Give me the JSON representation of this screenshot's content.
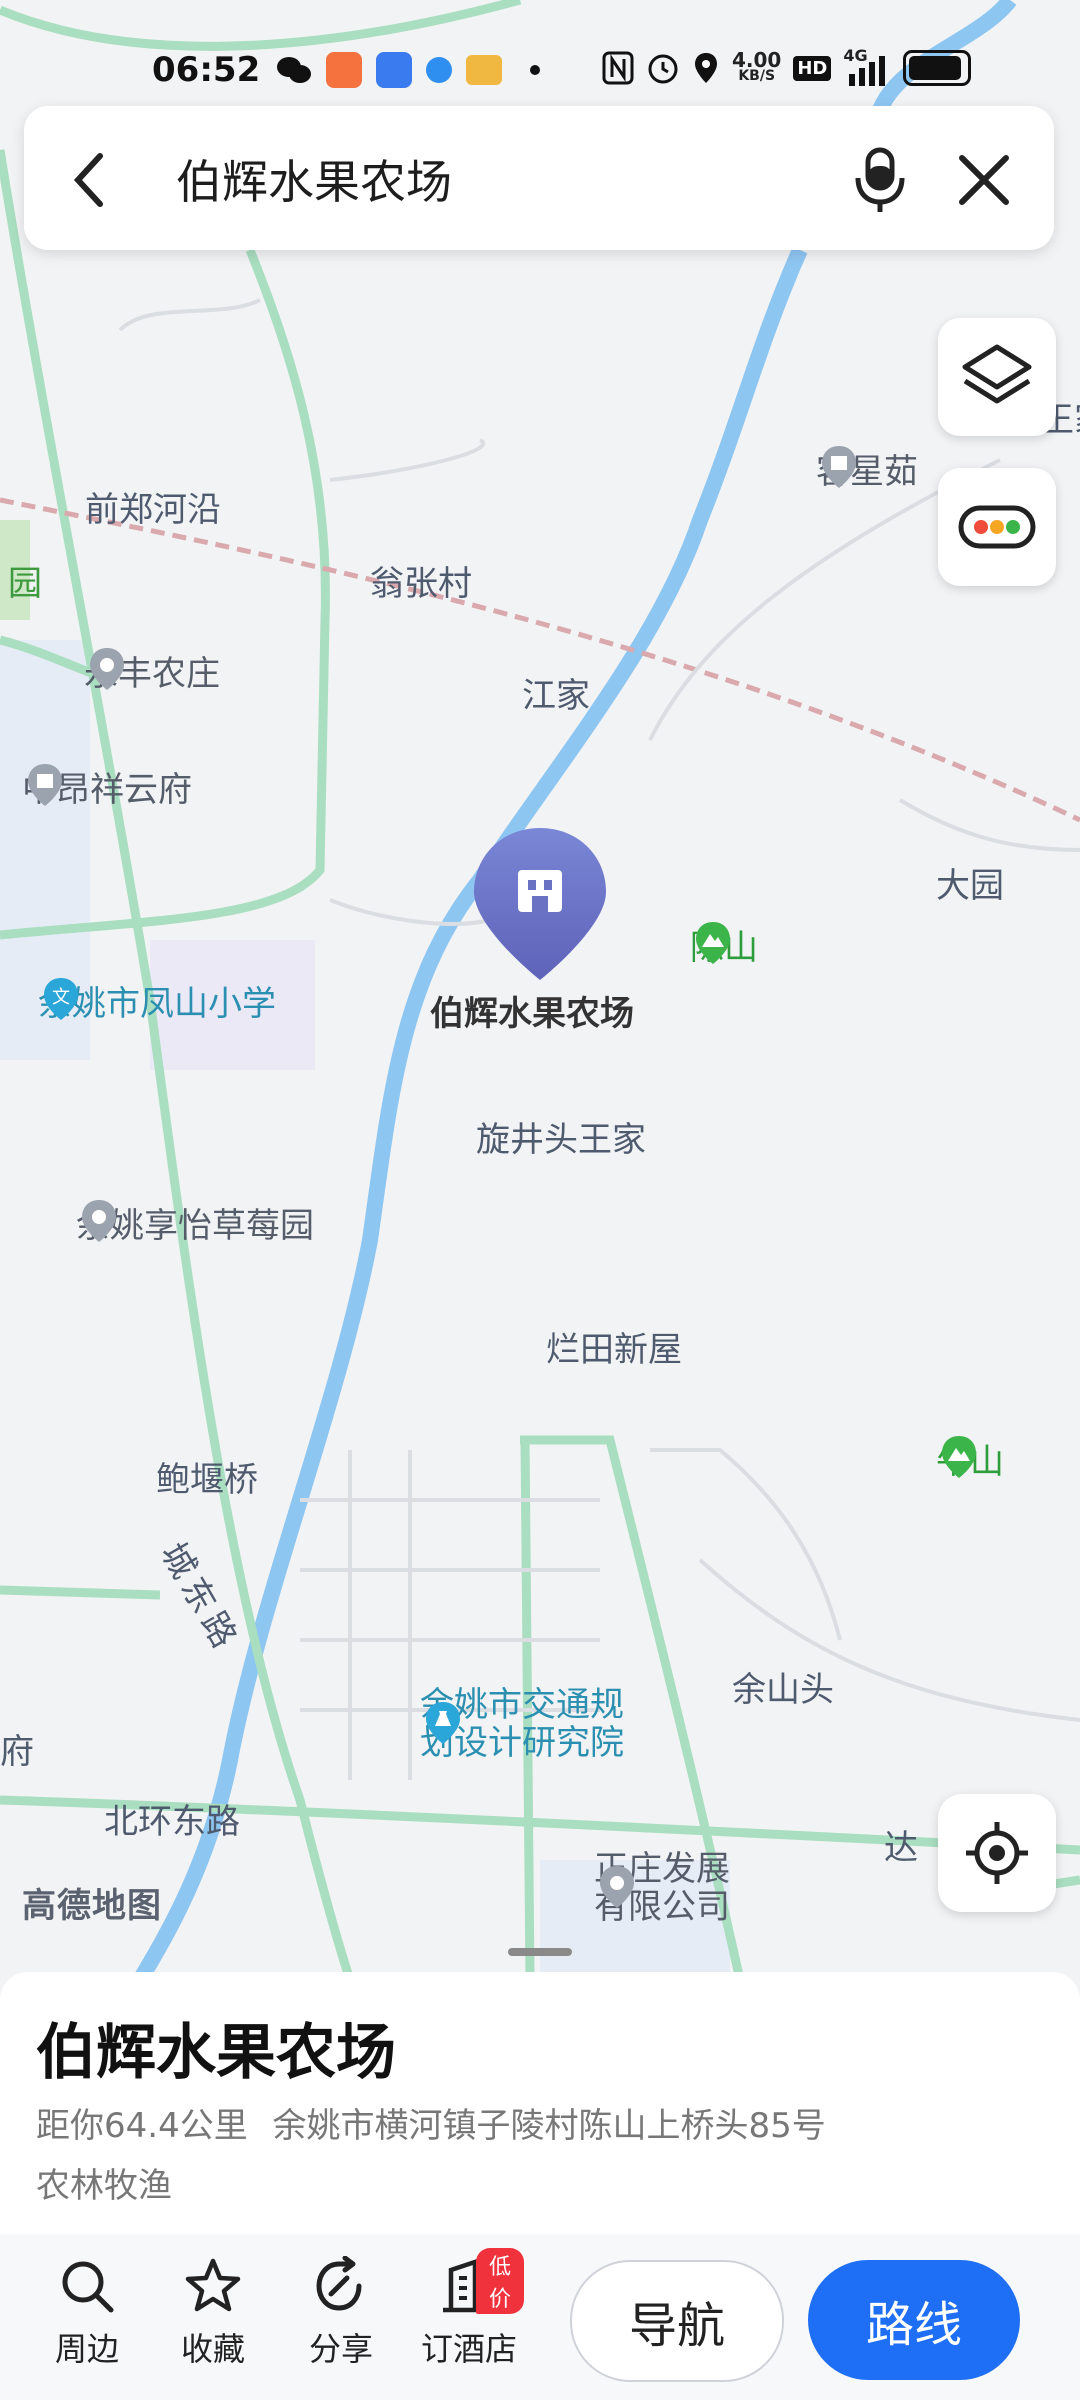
{
  "status_bar": {
    "time": "06:52",
    "net_speed_value": "4.00",
    "net_speed_unit": "KB/S",
    "hd": "HD",
    "signal": "4G"
  },
  "search": {
    "query": "伯辉水果农场"
  },
  "map": {
    "selected_marker_label": "伯辉水果农场",
    "logo_text": "高德地图",
    "place_labels": {
      "qianzheng": "前郑河沿",
      "wengzhang": "翁张村",
      "jiangjia": "江家",
      "dayuan": "大园",
      "xuanjing": "旋井头王家",
      "lantian": "烂田新屋",
      "baoyanqiao": "鲍堰桥",
      "chengdonglu": "城东路",
      "yushantou": "余山头",
      "beihuan": "北环东路",
      "da": "达",
      "yuan_left": "园",
      "fu_left": "府",
      "jia_right": "王家"
    },
    "pois": {
      "yongfeng": "永丰农庄",
      "zhongang": "中昂祥云府",
      "fengshan_school": "余姚市凤山小学",
      "caomei": "余姚享怡草莓园",
      "chenshan": "陈山",
      "niushan": "牛山",
      "kexing": "客星茹",
      "jiaotong_line1": "余姚市交通规",
      "jiaotong_line2": "划设计研究院",
      "zhengzhuang_line1": "正庄发展",
      "zhengzhuang_line2": "有限公司"
    }
  },
  "place": {
    "name": "伯辉水果农场",
    "distance": "距你64.4公里",
    "address": "余姚市横河镇子陵村陈山上桥头85号",
    "category": "农林牧渔"
  },
  "actions": {
    "nearby": "周边",
    "favorite": "收藏",
    "share": "分享",
    "hotel": "订酒店",
    "hotel_badge": "低价"
  },
  "buttons": {
    "navigate": "导航",
    "route": "路线"
  }
}
